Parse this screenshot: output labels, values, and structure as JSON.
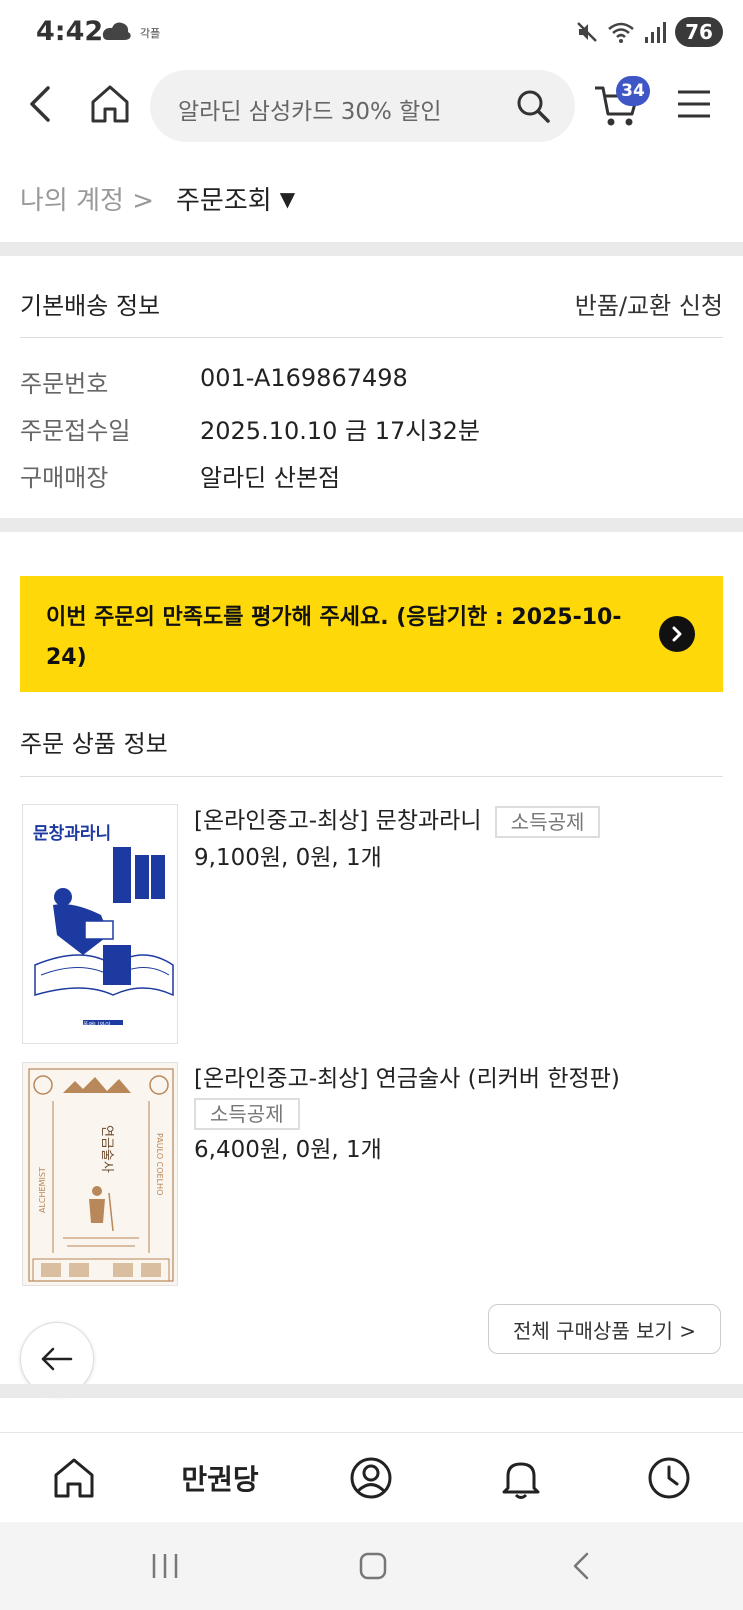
{
  "status_bar": {
    "time": "4:42",
    "small_label": "각플",
    "battery": "76"
  },
  "header": {
    "search_text": "알라딘 삼성카드 30% 할인",
    "cart_count": "34"
  },
  "breadcrumb": {
    "parent": "나의 계정 >",
    "current": "주문조회"
  },
  "shipping": {
    "title": "기본배송 정보",
    "return_link": "반품/교환 신청",
    "rows": [
      {
        "label": "주문번호",
        "value": "001-A169867498"
      },
      {
        "label": "주문접수일",
        "value": "2025.10.10 금 17시32분"
      },
      {
        "label": "구매매장",
        "value": "알라딘 산본점"
      }
    ]
  },
  "survey_banner": {
    "text": "이번 주문의 만족도를 평가해 주세요. (응답기한 : 2025-10-24)",
    "bg_color": "#ffd80a"
  },
  "products": {
    "title": "주문 상품 정보",
    "items": [
      {
        "name": "[온라인중고-최상] 문창과라니",
        "tag": "소득공제",
        "price": "9,100원, 0원, 1개",
        "cover_title": "문창과라니",
        "cover_publisher": "폴앤니와이"
      },
      {
        "name": "[온라인중고-최상] 연금술사 (리커버 한정판)",
        "tag": "소득공제",
        "price": "6,400원, 0원, 1개",
        "cover_title": "연금술사",
        "cover_side_left": "ALCHEMIST",
        "cover_side_right": "PAULO COELHO"
      }
    ],
    "view_all": "전체 구매상품 보기 >"
  },
  "bottom_nav": {
    "brand": "만권당"
  },
  "colors": {
    "accent_badge": "#3e56c6",
    "banner": "#ffd80a"
  }
}
